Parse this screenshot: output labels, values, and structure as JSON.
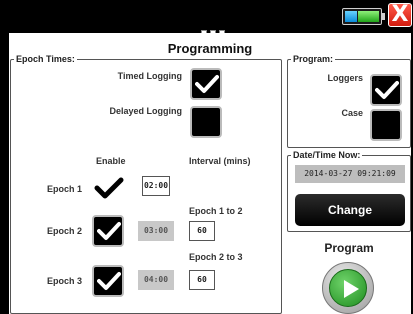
{
  "header": {
    "title": "Programming",
    "page_indicator_count": 3,
    "close_glyph": "X"
  },
  "epoch_times": {
    "legend": "Epoch Times:",
    "timed_logging_label": "Timed Logging",
    "timed_logging_checked": true,
    "delayed_logging_label": "Delayed Logging",
    "delayed_logging_checked": false,
    "enable_header": "Enable",
    "interval_header": "Interval (mins)",
    "epochs": [
      {
        "label": "Epoch 1",
        "enabled": true,
        "time": "02:00",
        "time_disabled": false
      },
      {
        "label": "Epoch 2",
        "enabled": true,
        "time": "03:00",
        "time_disabled": true
      },
      {
        "label": "Epoch 3",
        "enabled": true,
        "time": "04:00",
        "time_disabled": true
      }
    ],
    "intervals": [
      {
        "label": "Epoch 1 to 2",
        "value": "60"
      },
      {
        "label": "Epoch 2 to 3",
        "value": "60"
      }
    ]
  },
  "program_group": {
    "legend": "Program:",
    "loggers_label": "Loggers",
    "loggers_checked": true,
    "case_label": "Case",
    "case_checked": false
  },
  "datetime": {
    "legend": "Date/Time Now:",
    "value": "2014-03-27  09:21:09",
    "change_label": "Change"
  },
  "program_action": {
    "label": "Program"
  },
  "colors": {
    "background": "#000000",
    "panel": "#ffffff",
    "close_red": "#e0271a",
    "play_green": "#2fa32c",
    "battery_blue": "#1ba0e8",
    "battery_green": "#3cc22f",
    "disabled_field": "#c8c8c8"
  },
  "icons": [
    "battery-icon",
    "close-icon",
    "check-icon",
    "play-icon"
  ]
}
